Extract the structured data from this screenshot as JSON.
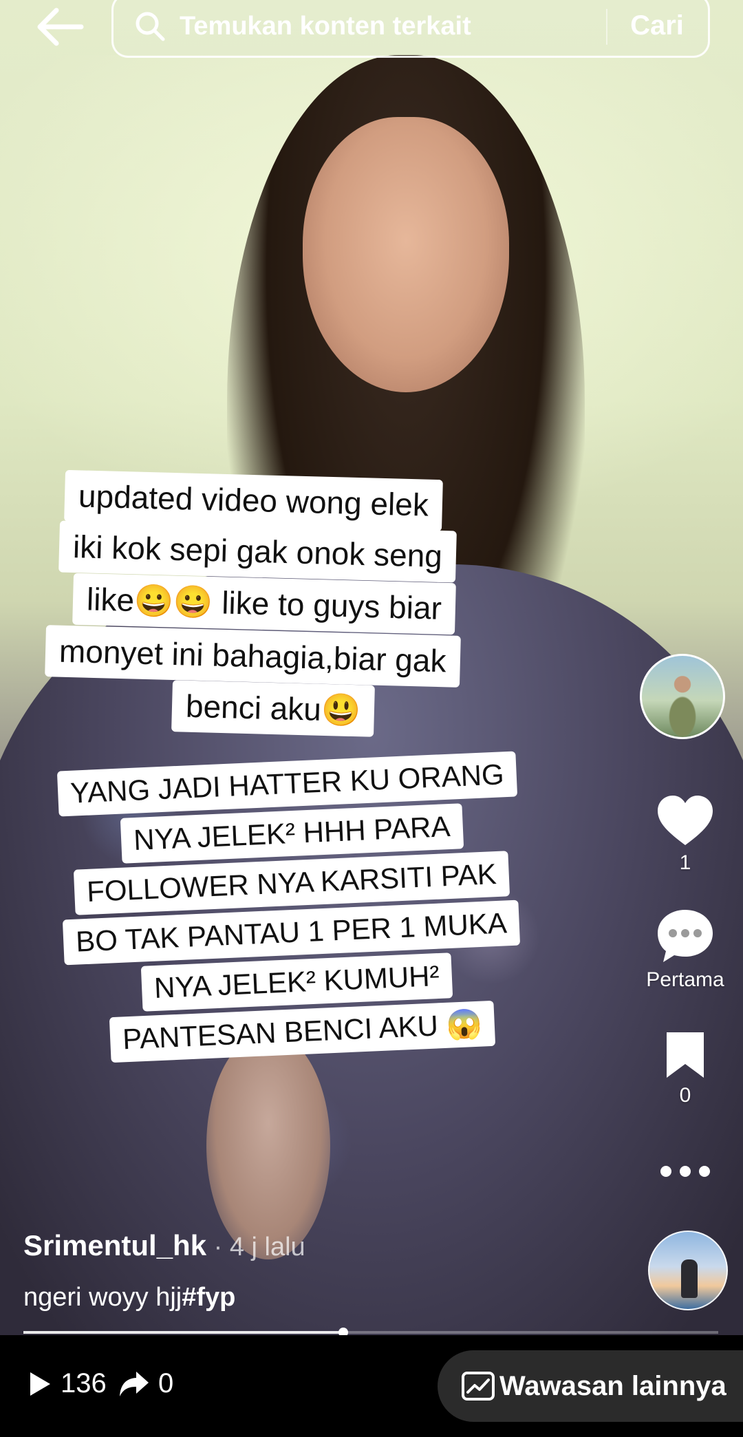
{
  "search": {
    "placeholder": "Temukan konten terkait",
    "button_label": "Cari"
  },
  "video": {
    "caption_top_lines": [
      "updated  video wong elek",
      "iki kok sepi gak onok seng",
      "like😀😀 like to guys biar",
      "monyet ini bahagia,biar gak",
      "benci aku😃"
    ],
    "caption_bottom_lines": [
      "YANG JADI HATTER KU ORANG",
      "NYA JELEK² HHH PARA",
      "FOLLOWER NYA KARSITI PAK",
      "BO TAK PANTAU 1 PER 1 MUKA",
      "NYA JELEK² KUMUH²",
      "PANTESAN BENCI AKU 😱"
    ]
  },
  "rail": {
    "like_count": "1",
    "comment_label": "Pertama",
    "save_count": "0"
  },
  "post": {
    "username": "Srimentul_hk",
    "time_ago": " · 4 j lalu",
    "description_text": "ngeri woyy hjj",
    "hashtag": "#fyp",
    "progress_fraction": 0.46
  },
  "bottom_bar": {
    "play_count": "136",
    "share_count": "0",
    "insights_label": "Wawasan lainnya"
  },
  "colors": {
    "bottom_bar_bg": "#000000",
    "insights_pill_bg": "#2b2b2b",
    "caption_bg": "#ffffff"
  }
}
